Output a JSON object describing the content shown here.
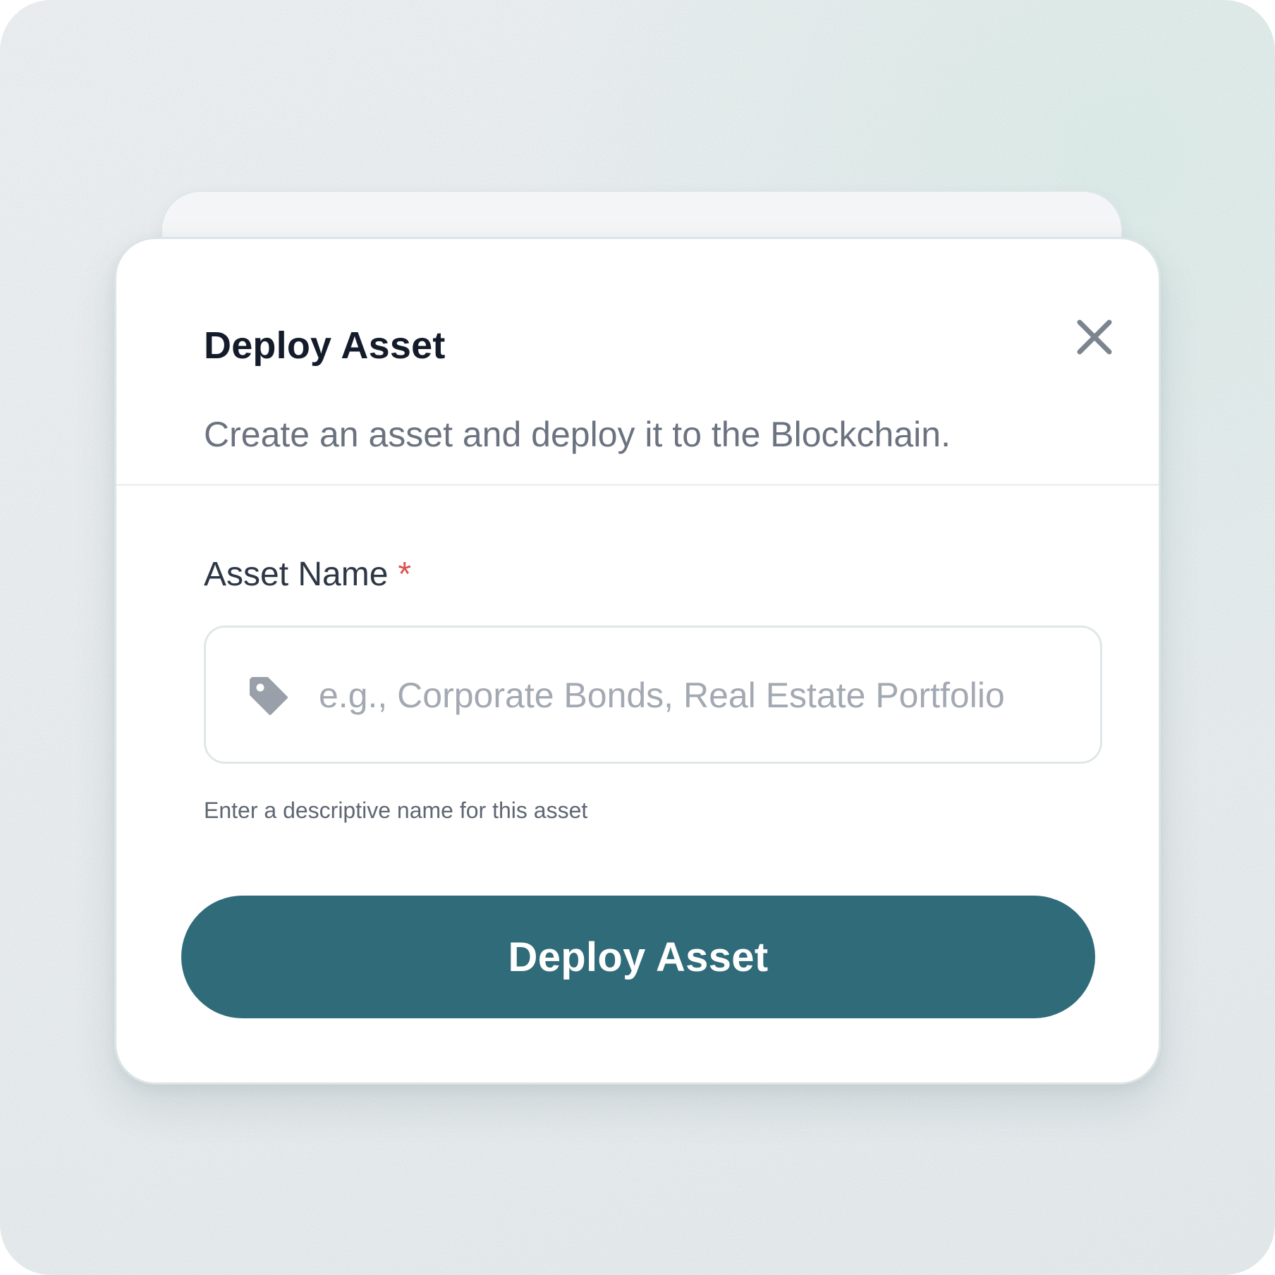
{
  "modal": {
    "title": "Deploy Asset",
    "subtitle": "Create an asset and deploy it to the Blockchain.",
    "close_icon": "close-icon"
  },
  "form": {
    "asset_name": {
      "label": "Asset Name",
      "required_marker": "*",
      "value": "",
      "placeholder": "e.g., Corporate Bonds, Real Estate Portfolio",
      "icon": "tag-icon",
      "help_text": "Enter a descriptive name for this asset"
    }
  },
  "actions": {
    "submit_label": "Deploy Asset"
  },
  "colors": {
    "primary": "#2f6b79",
    "title": "#141c2b",
    "muted_text": "#6b7380",
    "placeholder": "#a3a9b2",
    "required": "#d9534f",
    "icon": "#9aa0aa"
  }
}
